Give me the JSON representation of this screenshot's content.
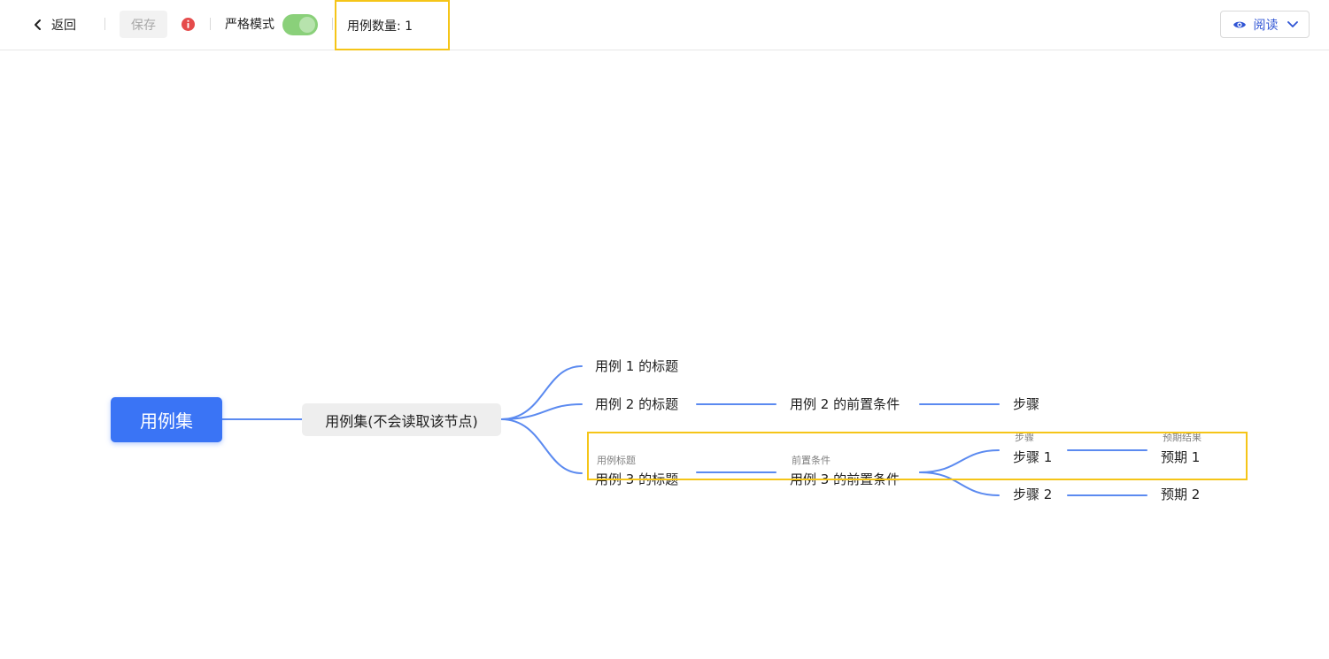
{
  "toolbar": {
    "back_label": "返回",
    "save_label": "保存",
    "strict_mode_label": "严格模式",
    "strict_mode_on": true,
    "case_count_label": "用例数量: 1",
    "view_mode_label": "阅读"
  },
  "mindmap": {
    "root_label": "用例集",
    "suite_label": "用例集(不会读取该节点)",
    "case1_title": "用例 1 的标题",
    "case2_title": "用例 2 的标题",
    "case2_precondition": "用例 2 的前置条件",
    "case2_step": "步骤",
    "case3_tag_title": "用例标题",
    "case3_title": "用例 3 的标题",
    "case3_tag_precondition": "前置条件",
    "case3_precondition": "用例 3 的前置条件",
    "case3_tag_step": "步骤",
    "case3_step1": "步骤 1",
    "case3_tag_expected": "预期结果",
    "case3_expected1": "预期 1",
    "case3_step2": "步骤 2",
    "case3_expected2": "预期 2"
  },
  "colors": {
    "accent": "#3a74f5",
    "link_line": "#5b8af0",
    "highlight": "#f5c518",
    "toggle_on": "#8ad07a",
    "info_icon": "#e54b4b"
  },
  "icons": [
    "chevron-left-icon",
    "info-icon",
    "eye-icon",
    "chevron-down-icon"
  ]
}
